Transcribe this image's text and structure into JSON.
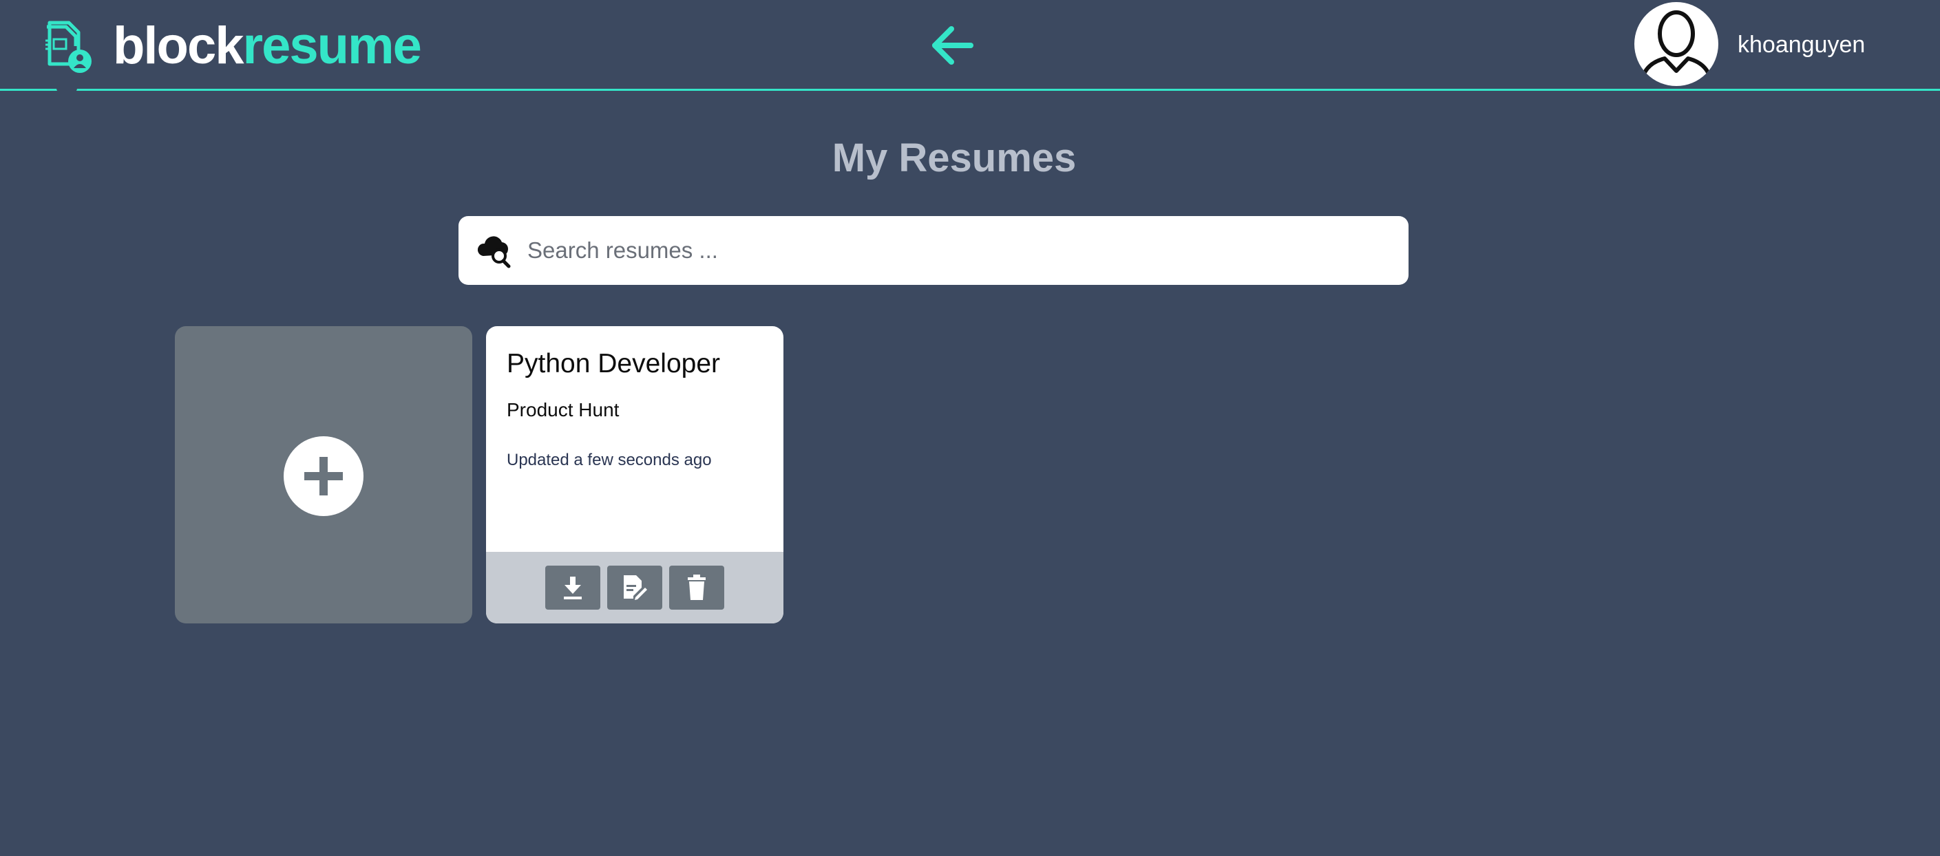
{
  "brand": {
    "part1": "block",
    "part2": "resume"
  },
  "user": {
    "name": "khoanguyen"
  },
  "page": {
    "title": "My Resumes"
  },
  "search": {
    "placeholder": "Search resumes ...",
    "value": ""
  },
  "resumes": [
    {
      "title": "Python Developer",
      "company": "Product Hunt",
      "updated": "Updated a few seconds ago"
    }
  ],
  "colors": {
    "background": "#3c4960",
    "accent": "#34e5c8",
    "card_gray": "#6a747d",
    "card_footer": "#c6cbd2"
  },
  "icons": {
    "logo": "resume-document-icon",
    "back": "arrow-left-icon",
    "avatar": "user-silhouette-icon",
    "search": "cloud-search-icon",
    "add": "plus-circle-icon",
    "download": "download-icon",
    "edit": "edit-document-icon",
    "delete": "trash-icon"
  }
}
